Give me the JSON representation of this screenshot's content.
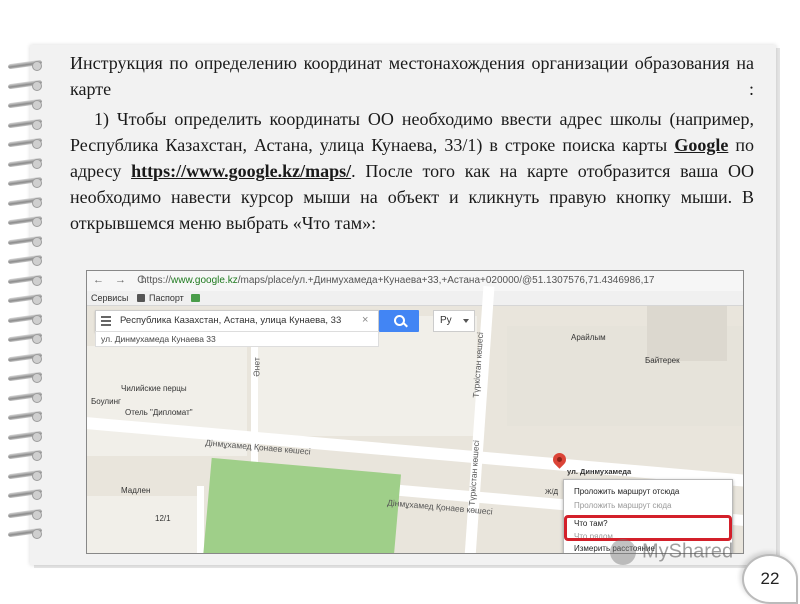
{
  "slide": {
    "paragraph1": "Инструкция по определению координат местонахождения организации образования на карте :",
    "paragraph2_before_google": "1) Чтобы определить координаты ОО необходимо ввести адрес школы (например, Республика Казахстан, Астана, улица Кунаева, 33/1) в строке поиска карты ",
    "google_link": "Google",
    "paragraph2_between": " по адресу ",
    "maps_link": "https://www.google.kz/maps/",
    "paragraph2_after": ". После того как на карте отобразится ваша ОО необходимо навести курсор мыши на объект и кликнуть правую кнопку мыши. В открывшемся меню выбрать «Что там»:",
    "page_number": "22",
    "watermark": "MyShared"
  },
  "browser": {
    "nav": "← → C",
    "url_prefix": "https://",
    "url_domain": "www.google.kz",
    "url_rest": "/maps/place/ул.+Динмухамеда+Кунаева+33,+Астана+020000/@51.1307576,71.4346986,17",
    "bookmarks": [
      "Сервисы",
      "Паспорт"
    ]
  },
  "map": {
    "search_value": "Республика Казахстан, Астана, улица Кунаева, 33",
    "search_clear": "×",
    "language": "Ру",
    "sub_address": "ул. Динмухамеда Кунаева 33",
    "labels": {
      "arailym": "Арайлым",
      "baiterek": "Байтерек",
      "chili": "Чилийские перцы",
      "bouling": "Боулинг",
      "diplomat": "Отель \"Дипломат\"",
      "madlen": "Мадлен",
      "num12": "12/1",
      "pin_label": "ул. Динмухамеда",
      "zhd": "Ж/Д"
    },
    "streets": {
      "konaev_top": "Дінмұхамед Қонаев көшесі",
      "konaev_bottom": "Дінмұхамед Қонаев көшесі",
      "turkistan_top": "Түркістан көшесі",
      "turkistan_bottom": "Түркістан көшесі",
      "side": "Әнет"
    },
    "context_menu": [
      "Проложить маршрут отсюда",
      "Проложить маршрут сюда",
      "Что там?",
      "Что рядом",
      "Измерить расстояние"
    ]
  }
}
